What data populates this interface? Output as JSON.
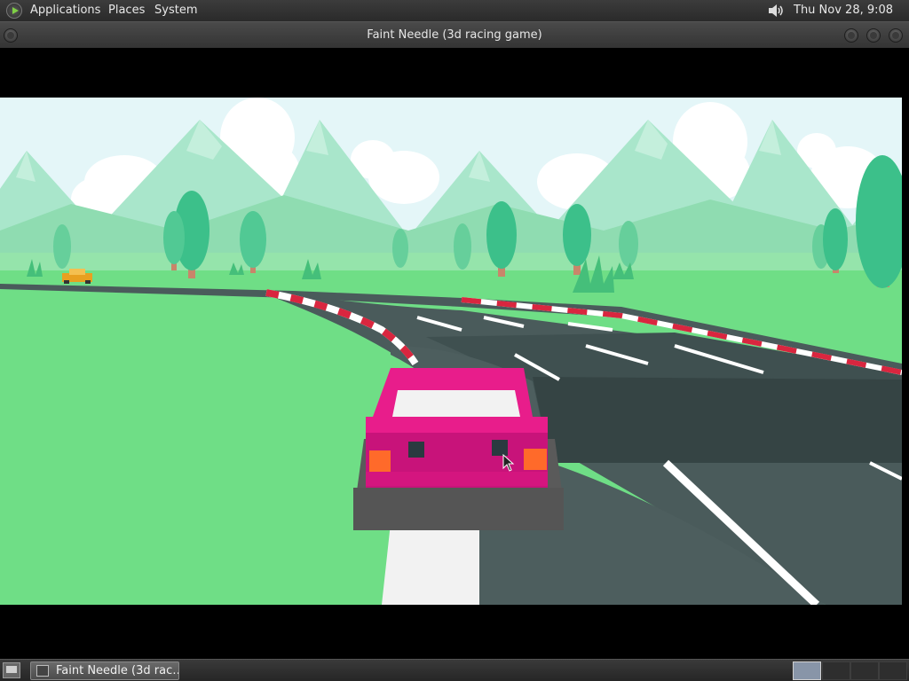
{
  "top_panel": {
    "menus": [
      "Applications",
      "Places",
      "System"
    ],
    "clock": "Thu Nov 28,  9:08 PM"
  },
  "window": {
    "title": "Faint Needle (3d racing game)"
  },
  "game": {
    "player_car_color": "#e81d8b",
    "sky_color": "#e4f6f8",
    "grass_color": "#6fde86",
    "road_color": "#4a5b5b",
    "curb_colors": [
      "#d9263f",
      "#ffffff"
    ]
  },
  "taskbar": {
    "task_label": "Faint Needle (3d rac…"
  }
}
